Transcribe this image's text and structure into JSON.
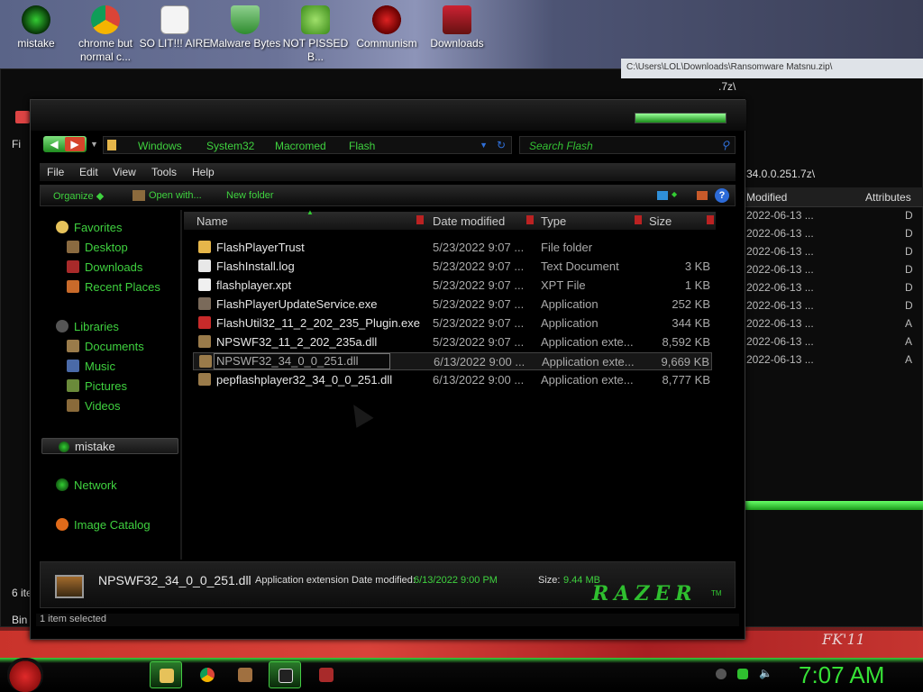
{
  "desktop": {
    "icons": [
      {
        "label": "mistake",
        "icon": "orb-icon"
      },
      {
        "label": "chrome but normal c...",
        "icon": "chrome-icon"
      },
      {
        "label": "SO LIT!!! AIRE",
        "icon": "cards-icon"
      },
      {
        "label": "Malware Bytes",
        "icon": "shield-icon"
      },
      {
        "label": "NOT PISSED B...",
        "icon": "pig-icon"
      },
      {
        "label": "Communism",
        "icon": "hammer-icon"
      },
      {
        "label": "Downloads",
        "icon": "downloads-icon"
      }
    ],
    "signature": "FK'11"
  },
  "bg_window": {
    "title": "C:\\Users\\LOL\\Downloads\\Ransomware Matsnu.zip\\",
    "path_tail": ".7z\\",
    "path2": "34.0.0.251.7z\\",
    "left_labels": [
      "Fi",
      "6 ite",
      "Bin"
    ],
    "columns": [
      "Modified",
      "Attributes"
    ],
    "rows": [
      {
        "date": "2022-06-13 ...",
        "attr": "D"
      },
      {
        "date": "2022-06-13 ...",
        "attr": "D"
      },
      {
        "date": "2022-06-13 ...",
        "attr": "D"
      },
      {
        "date": "2022-06-13 ...",
        "attr": "D"
      },
      {
        "date": "2022-06-13 ...",
        "attr": "D"
      },
      {
        "date": "2022-06-13 ...",
        "attr": "D"
      },
      {
        "date": "2022-06-13 ...",
        "attr": "A"
      },
      {
        "date": "2022-06-13 ...",
        "attr": "A"
      },
      {
        "date": "2022-06-13 ...",
        "attr": "A"
      }
    ]
  },
  "explorer": {
    "breadcrumb": [
      "Windows",
      "System32",
      "Macromed",
      "Flash"
    ],
    "search_placeholder": "Search Flash",
    "menu": [
      "File",
      "Edit",
      "View",
      "Tools",
      "Help"
    ],
    "commands": [
      "Organize",
      "Open with...",
      "New folder"
    ],
    "nav": {
      "favorites": "Favorites",
      "fav_items": [
        "Desktop",
        "Downloads",
        "Recent Places"
      ],
      "libraries": "Libraries",
      "lib_items": [
        "Documents",
        "Music",
        "Pictures",
        "Videos"
      ],
      "homegroup": "mistake",
      "network": "Network",
      "image_catalog": "Image Catalog"
    },
    "columns": [
      "Name",
      "Date modified",
      "Type",
      "Size"
    ],
    "files": [
      {
        "name": "FlashPlayerTrust",
        "date": "5/23/2022 9:07 ...",
        "type": "File folder",
        "size": "",
        "icon": "folder-icon"
      },
      {
        "name": "FlashInstall.log",
        "date": "5/23/2022 9:07 ...",
        "type": "Text Document",
        "size": "3 KB",
        "icon": "text-file-icon"
      },
      {
        "name": "flashplayer.xpt",
        "date": "5/23/2022 9:07 ...",
        "type": "XPT File",
        "size": "1 KB",
        "icon": "file-icon"
      },
      {
        "name": "FlashPlayerUpdateService.exe",
        "date": "5/23/2022 9:07 ...",
        "type": "Application",
        "size": "252 KB",
        "icon": "app-icon"
      },
      {
        "name": "FlashUtil32_11_2_202_235_Plugin.exe",
        "date": "5/23/2022 9:07 ...",
        "type": "Application",
        "size": "344 KB",
        "icon": "flash-icon"
      },
      {
        "name": "NPSWF32_11_2_202_235a.dll",
        "date": "5/23/2022 9:07 ...",
        "type": "Application exte...",
        "size": "8,592 KB",
        "icon": "dll-icon"
      },
      {
        "name": "NPSWF32_34_0_0_251.dll",
        "date": "6/13/2022 9:00 ...",
        "type": "Application exte...",
        "size": "9,669 KB",
        "icon": "dll-icon"
      },
      {
        "name": "pepflashplayer32_34_0_0_251.dll",
        "date": "6/13/2022 9:00 ...",
        "type": "Application exte...",
        "size": "8,777 KB",
        "icon": "dll-icon"
      }
    ],
    "details": {
      "name": "NPSWF32_34_0_0_251.dll",
      "type_label": "Application extension Date modified:",
      "date": "6/13/2022 9:00 PM",
      "size_label": "Size:",
      "size": "9.44 MB",
      "brand": "RAZER",
      "tm": "TM"
    },
    "status": "1 item selected"
  },
  "taskbar": {
    "clock": "7:07 AM"
  },
  "colors": {
    "accent_green": "#3fd23f",
    "window_bg": "#000000",
    "start_red": "#e02a2a"
  }
}
